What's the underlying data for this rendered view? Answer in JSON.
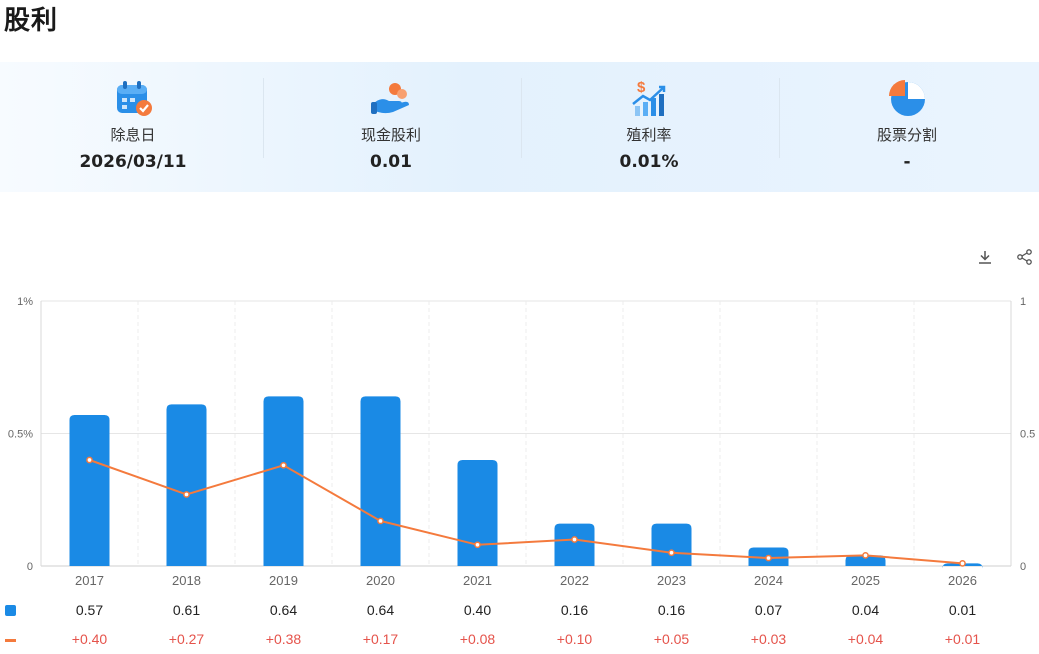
{
  "page": {
    "title": "股利"
  },
  "summary": [
    {
      "label": "除息日",
      "value": "2026/03/11",
      "icon": "calendar-check-icon"
    },
    {
      "label": "现金股利",
      "value": "0.01",
      "icon": "hand-coins-icon"
    },
    {
      "label": "殖利率",
      "value": "0.01%",
      "icon": "dollar-growth-chart-icon"
    },
    {
      "label": "股票分割",
      "value": "-",
      "icon": "pie-chart-icon"
    }
  ],
  "toolbar": {
    "download_icon": "download-icon",
    "share_icon": "share-icon"
  },
  "colors": {
    "bar": "#1a8ae5",
    "line": "#f47a3d",
    "change_text": "#e5534b",
    "grid": "#e6e6e6"
  },
  "chart_data": {
    "type": "bar",
    "categories": [
      "2017",
      "2018",
      "2019",
      "2020",
      "2021",
      "2022",
      "2023",
      "2024",
      "2025",
      "2026"
    ],
    "series": [
      {
        "type": "bar",
        "axis": "left",
        "values": [
          0.57,
          0.61,
          0.64,
          0.64,
          0.4,
          0.16,
          0.16,
          0.07,
          0.04,
          0.01
        ]
      },
      {
        "type": "line",
        "axis": "right",
        "values": [
          0.4,
          0.27,
          0.38,
          0.17,
          0.08,
          0.1,
          0.05,
          0.03,
          0.04,
          0.01
        ]
      }
    ],
    "y_left": {
      "ticks": [
        "0",
        "0.5%",
        "1%"
      ],
      "range": [
        0,
        1
      ]
    },
    "y_right": {
      "ticks": [
        "0",
        "0.5",
        "1"
      ],
      "range": [
        0,
        1
      ]
    },
    "table_rows": [
      {
        "marker": "bar",
        "values": [
          "0.57",
          "0.61",
          "0.64",
          "0.64",
          "0.40",
          "0.16",
          "0.16",
          "0.07",
          "0.04",
          "0.01"
        ]
      },
      {
        "marker": "line",
        "values": [
          "+0.40",
          "+0.27",
          "+0.38",
          "+0.17",
          "+0.08",
          "+0.10",
          "+0.05",
          "+0.03",
          "+0.04",
          "+0.01"
        ]
      }
    ],
    "grid": true
  }
}
